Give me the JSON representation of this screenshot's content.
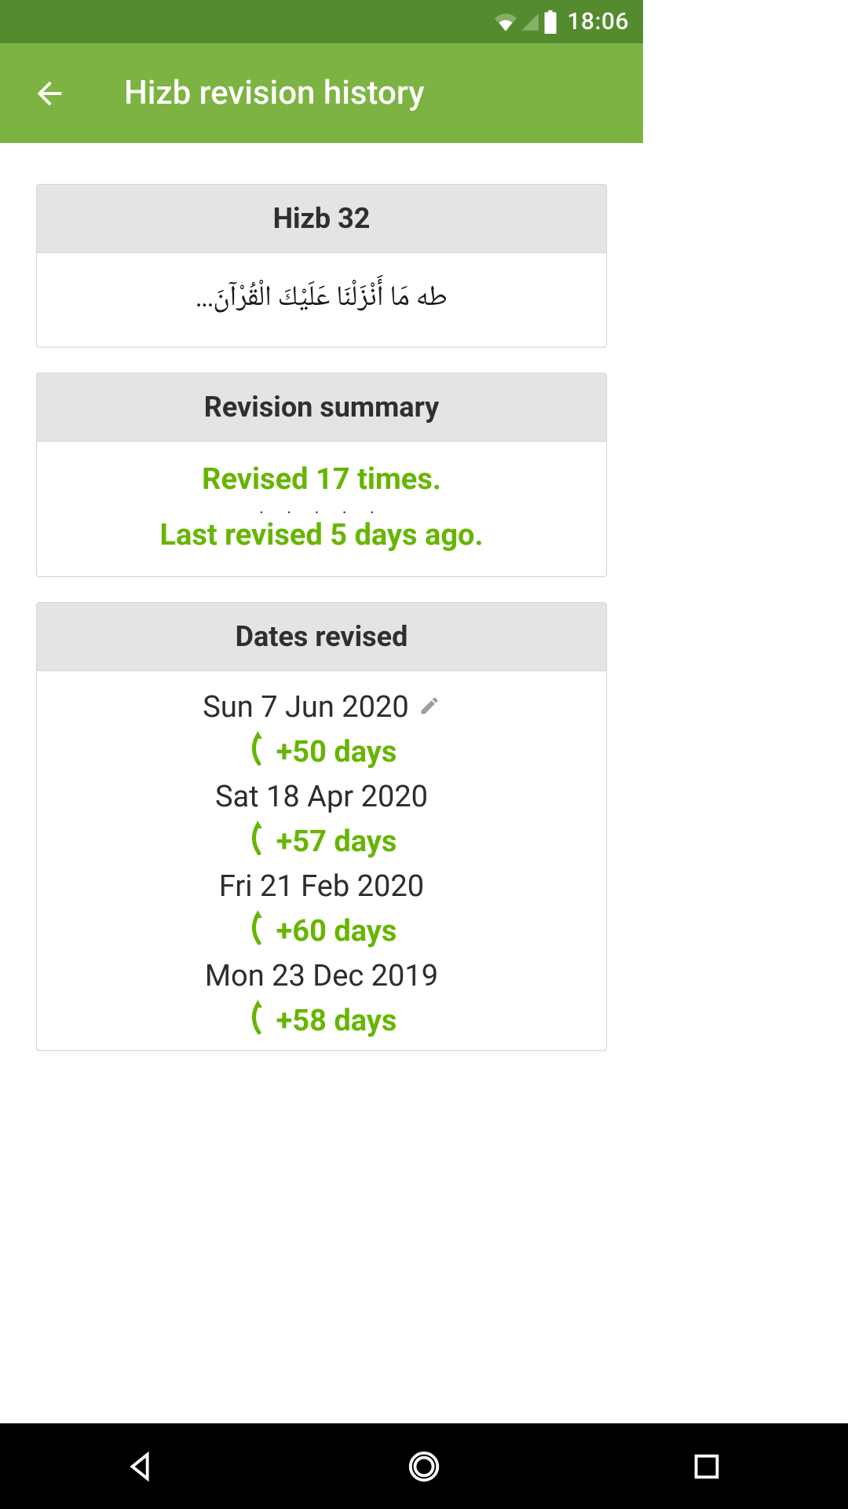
{
  "status": {
    "clock": "18:06"
  },
  "appbar": {
    "title": "Hizb revision history"
  },
  "hizb_card": {
    "header": "Hizb 32",
    "arabic": "طه مَا أَنْزَلْنَا عَلَيْكَ الْقُرْآنَ..."
  },
  "summary_card": {
    "header": "Revision summary",
    "line1": "Revised 17 times.",
    "dots": ". . . . .",
    "line2": "Last revised 5 days ago."
  },
  "dates_card": {
    "header": "Dates revised",
    "entries": [
      {
        "date": "Sun 7 Jun 2020",
        "editable": true
      },
      {
        "gap": "+50 days"
      },
      {
        "date": "Sat 18 Apr 2020"
      },
      {
        "gap": "+57 days"
      },
      {
        "date": "Fri 21 Feb 2020"
      },
      {
        "gap": "+60 days"
      },
      {
        "date": "Mon 23 Dec 2019"
      },
      {
        "gap": "+58 days"
      }
    ]
  },
  "colors": {
    "status_bar": "#558b2f",
    "app_bar": "#7cb342",
    "accent": "#67b502",
    "card_header_bg": "#e4e4e4"
  }
}
